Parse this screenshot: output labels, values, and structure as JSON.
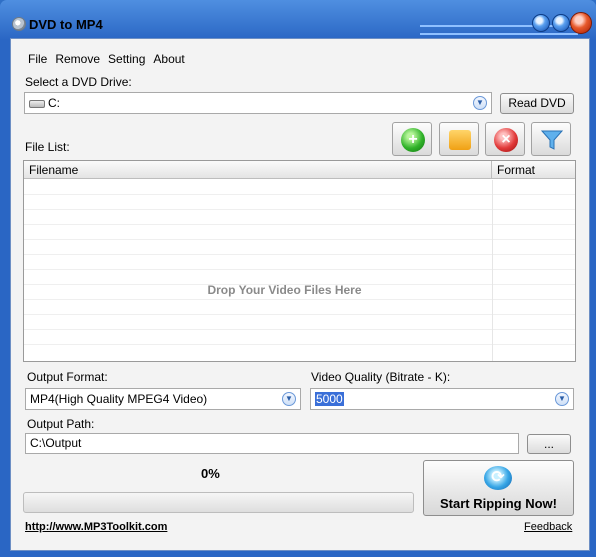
{
  "window": {
    "title": "DVD to MP4"
  },
  "menu": {
    "items": [
      "File",
      "Remove",
      "Setting",
      "About"
    ]
  },
  "drive": {
    "label": "Select a DVD Drive:",
    "value": "C:",
    "read_button": "Read DVD"
  },
  "filelist": {
    "label": "File List:",
    "columns": [
      "Filename",
      "Format"
    ],
    "drop_hint": "Drop Your Video Files Here",
    "toolbar": [
      "add-icon",
      "folder-icon",
      "remove-icon",
      "filter-icon"
    ]
  },
  "output_format": {
    "label": "Output Format:",
    "value": "MP4(High Quality MPEG4 Video)"
  },
  "video_quality": {
    "label": "Video Quality (Bitrate - K):",
    "value": "5000"
  },
  "output_path": {
    "label": "Output Path:",
    "value": "C:\\Output",
    "browse_button": "..."
  },
  "progress": {
    "text": "0%",
    "value": 0
  },
  "start_button": "Start Ripping Now!",
  "footer": {
    "website": "http://www.MP3Toolkit.com",
    "feedback": "Feedback"
  },
  "colors": {
    "accent": "#2a66c4",
    "selection": "#3a6fd8"
  }
}
